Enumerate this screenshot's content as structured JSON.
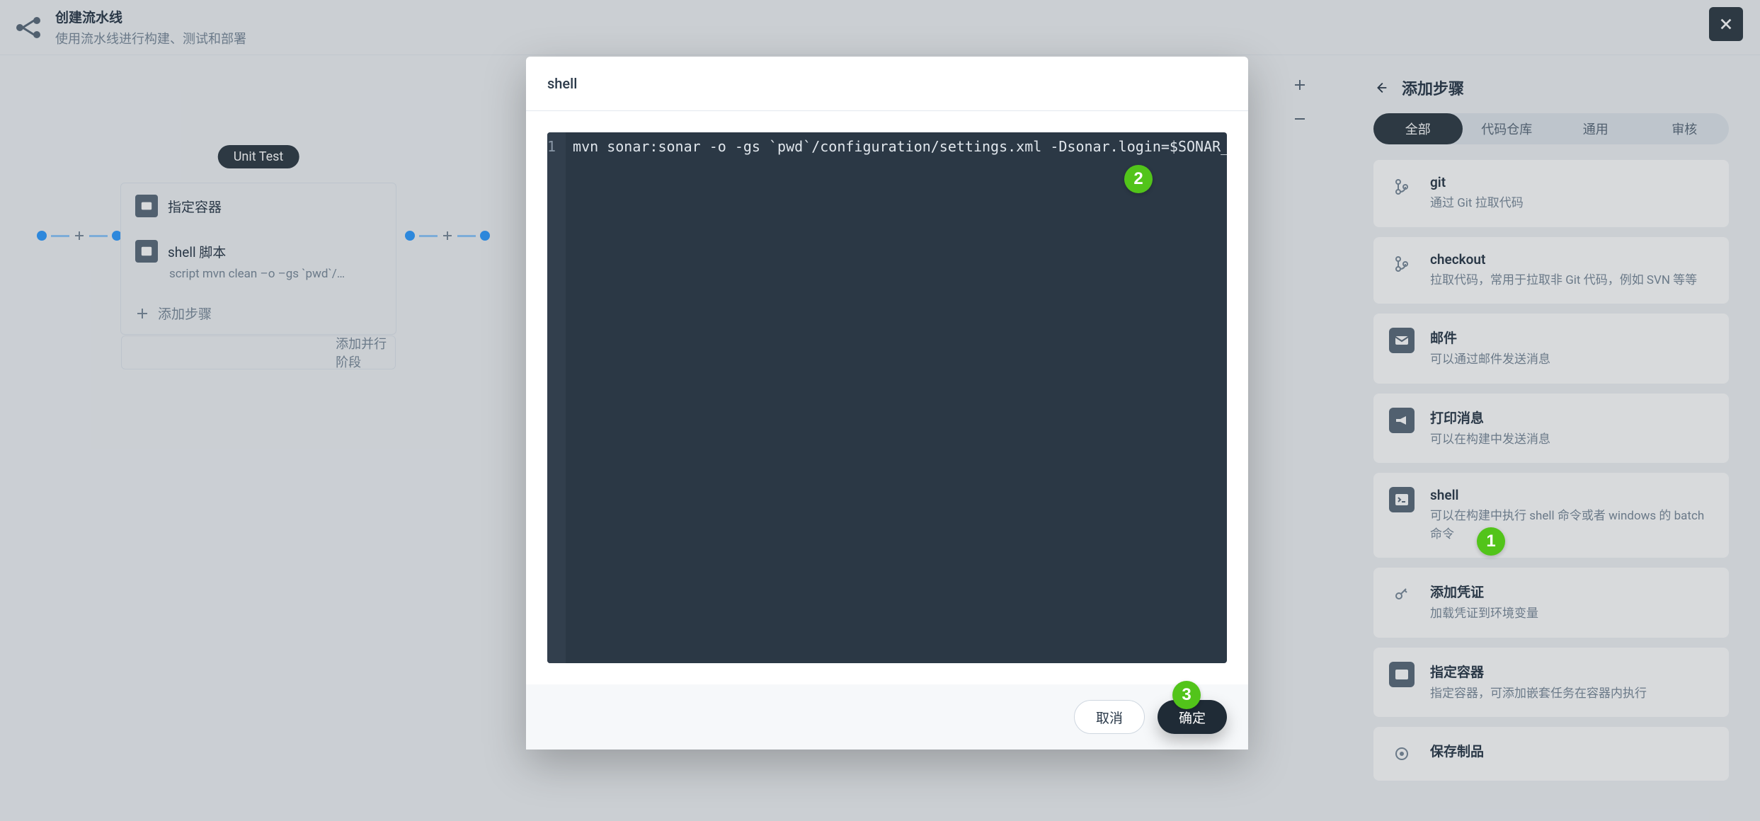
{
  "header": {
    "title": "创建流水线",
    "subtitle": "使用流水线进行构建、测试和部署"
  },
  "zoom": {
    "in": "+",
    "out": "−"
  },
  "stage1": {
    "label": "Unit Test",
    "row_container": "指定容器",
    "row_shell": "shell 脚本",
    "row_shell_sub": "script   mvn clean –o –gs `pwd`/…",
    "row_add_step": "添加步骤",
    "add_parallel": "添加并行阶段"
  },
  "sidebar": {
    "title": "添加步骤",
    "tabs": [
      "全部",
      "代码仓库",
      "通用",
      "审核"
    ],
    "steps": [
      {
        "key": "git",
        "title": "git",
        "desc": "通过 Git 拉取代码"
      },
      {
        "key": "checkout",
        "title": "checkout",
        "desc": "拉取代码，常用于拉取非 Git 代码，例如 SVN 等等"
      },
      {
        "key": "mail",
        "title": "邮件",
        "desc": "可以通过邮件发送消息"
      },
      {
        "key": "echo",
        "title": "打印消息",
        "desc": "可以在构建中发送消息"
      },
      {
        "key": "shell",
        "title": "shell",
        "desc": "可以在构建中执行 shell 命令或者 windows 的 batch 命令"
      },
      {
        "key": "cred",
        "title": "添加凭证",
        "desc": "加载凭证到环境变量"
      },
      {
        "key": "container",
        "title": "指定容器",
        "desc": "指定容器，可添加嵌套任务在容器内执行"
      },
      {
        "key": "archive",
        "title": "保存制品",
        "desc": ""
      }
    ]
  },
  "modal": {
    "title": "shell",
    "line_no": "1",
    "code": "mvn sonar:sonar -o -gs `pwd`/configuration/settings.xml -Dsonar.login=$SONAR_TOKEN",
    "cancel": "取消",
    "confirm": "确定"
  },
  "callouts": {
    "one": "1",
    "two": "2",
    "three": "3"
  }
}
